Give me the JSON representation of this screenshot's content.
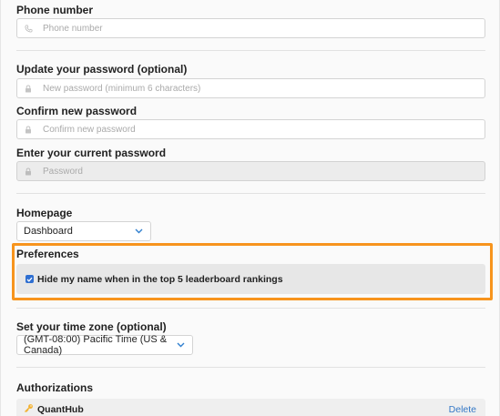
{
  "phone": {
    "label": "Phone number",
    "placeholder": "Phone number",
    "icon": "phone-icon"
  },
  "update_password": {
    "label": "Update your password (optional)",
    "placeholder": "New password (minimum 6 characters)",
    "icon": "lock-icon"
  },
  "confirm_password": {
    "label": "Confirm new password",
    "placeholder": "Confirm new password",
    "icon": "lock-icon"
  },
  "current_password": {
    "label": "Enter your current password",
    "placeholder": "Password",
    "icon": "lock-icon"
  },
  "homepage": {
    "label": "Homepage",
    "selected": "Dashboard"
  },
  "preferences": {
    "label": "Preferences",
    "hide_name": {
      "checked": true,
      "label": "Hide my name when in the top 5 leaderboard rankings"
    },
    "highlight_color": "#f7941d"
  },
  "timezone": {
    "label": "Set your time zone (optional)",
    "selected": "(GMT-08:00) Pacific Time (US & Canada)"
  },
  "authorizations": {
    "label": "Authorizations",
    "items": [
      {
        "name": "QuantHub",
        "action": "Delete",
        "icon": "key-icon"
      }
    ]
  },
  "colors": {
    "accent": "#2f6fd1",
    "link": "#3478c6",
    "chevron": "#2f7fcf"
  }
}
